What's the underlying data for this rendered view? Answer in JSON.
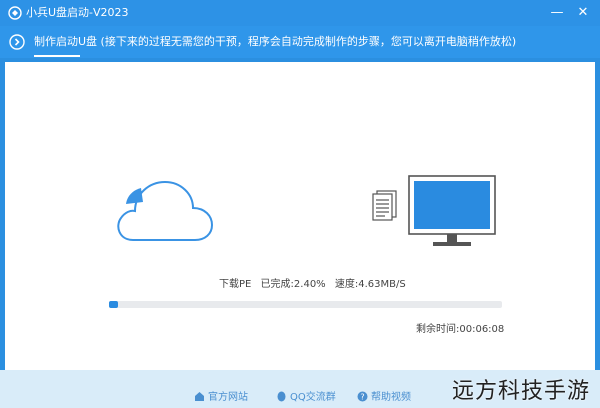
{
  "window": {
    "title": "小兵U盘启动-V2023",
    "minimize_label": "—",
    "close_label": "✕"
  },
  "notice": {
    "text": "制作启动U盘 (接下来的过程无需您的干预，程序会自动完成制作的步骤，您可以离开电脑稍作放松)"
  },
  "progress": {
    "step_label": "下载PE",
    "completed_label": "已完成:2.40%",
    "speed_label": "速度:4.63MB/S",
    "percent": 2.4,
    "remaining_label": "剩余时间:00:06:08"
  },
  "footer": {
    "links": [
      {
        "label": "官方网站",
        "icon": "home-icon"
      },
      {
        "label": "QQ交流群",
        "icon": "qq-icon"
      },
      {
        "label": "帮助视频",
        "icon": "help-icon"
      }
    ]
  },
  "watermark": "远方科技手游",
  "colors": {
    "titlebar": "#2d92e6",
    "accent": "#2a8be0",
    "footer_bg": "#d9ecf9"
  }
}
